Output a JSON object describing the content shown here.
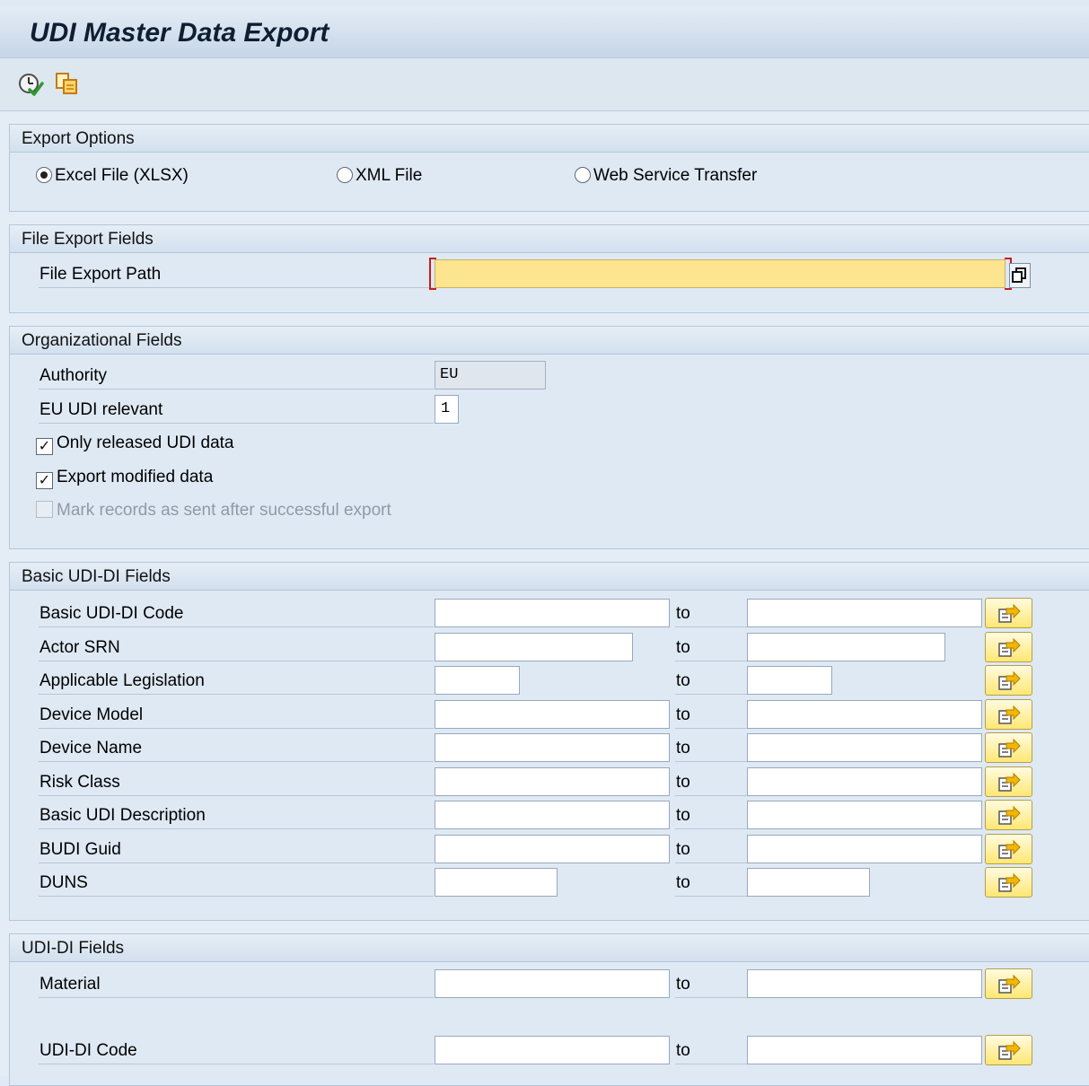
{
  "title": "UDI Master Data Export",
  "toolbar": {
    "icons": [
      "execute-clock-icon",
      "copy-variant-icon"
    ]
  },
  "export_options": {
    "header": "Export Options",
    "options": [
      {
        "label": "Excel File (XLSX)",
        "selected": true
      },
      {
        "label": "XML File",
        "selected": false
      },
      {
        "label": "Web Service Transfer",
        "selected": false
      }
    ]
  },
  "file_export": {
    "header": "File Export Fields",
    "path_label": "File Export Path",
    "path_value": ""
  },
  "organizational": {
    "header": "Organizational Fields",
    "authority_label": "Authority",
    "authority_value": "EU",
    "eu_udi_label": "EU UDI relevant",
    "eu_udi_value": "1",
    "checkboxes": [
      {
        "label": "Only released UDI data",
        "checked": true,
        "enabled": true
      },
      {
        "label": "Export modified data",
        "checked": true,
        "enabled": true
      },
      {
        "label": "Mark records as sent after successful export",
        "checked": false,
        "enabled": false
      }
    ]
  },
  "basic_udi": {
    "header": "Basic UDI-DI Fields",
    "to_label": "to",
    "rows": [
      {
        "label": "Basic UDI-DI Code",
        "from": "",
        "to": ""
      },
      {
        "label": "Actor SRN",
        "from": "",
        "to": ""
      },
      {
        "label": "Applicable Legislation",
        "from": "",
        "to": ""
      },
      {
        "label": "Device Model",
        "from": "",
        "to": ""
      },
      {
        "label": "Device Name",
        "from": "",
        "to": ""
      },
      {
        "label": "Risk Class",
        "from": "",
        "to": ""
      },
      {
        "label": "Basic UDI Description",
        "from": "",
        "to": ""
      },
      {
        "label": "BUDI Guid",
        "from": "",
        "to": ""
      },
      {
        "label": "DUNS",
        "from": "",
        "to": ""
      }
    ]
  },
  "udi_di": {
    "header": "UDI-DI Fields",
    "to_label": "to",
    "rows": [
      {
        "label": "Material",
        "from": "",
        "to": ""
      },
      {
        "label": "UDI-DI Code",
        "from": "",
        "to": ""
      }
    ]
  },
  "colors": {
    "required_field": "#fde48f",
    "selection_button": "#ffe773",
    "header_bg": "#c6d6e7"
  }
}
